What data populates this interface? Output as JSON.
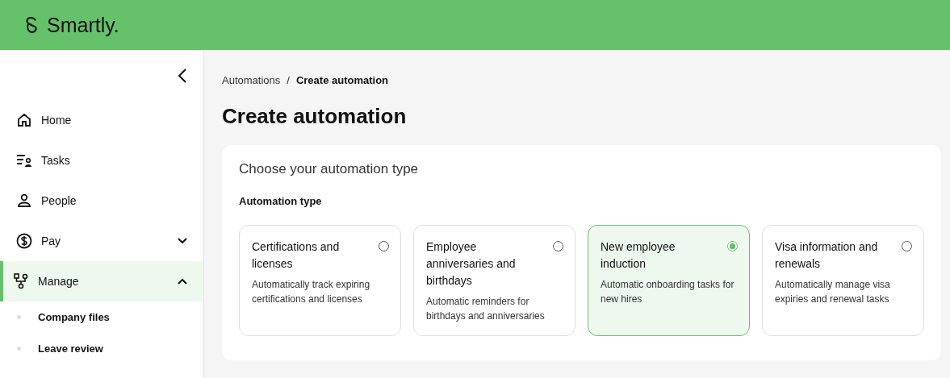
{
  "header": {
    "logo_text": "Smartly."
  },
  "sidebar": {
    "items": [
      {
        "label": "Home",
        "selected": false
      },
      {
        "label": "Tasks",
        "selected": false
      },
      {
        "label": "People",
        "selected": false
      },
      {
        "label": "Pay",
        "expanded": false,
        "selected": false
      },
      {
        "label": "Manage",
        "expanded": true,
        "selected": true,
        "children": [
          {
            "label": "Company files",
            "selected": false
          },
          {
            "label": "Leave review",
            "selected": false
          }
        ]
      }
    ]
  },
  "breadcrumb": [
    {
      "label": "Automations",
      "current": false
    },
    {
      "label": "Create automation",
      "current": true
    }
  ],
  "breadcrumb_separator": "/",
  "page_title": "Create automation",
  "panel": {
    "title": "Choose your automation type",
    "field_label": "Automation type",
    "options": [
      {
        "title": "Certifications and licenses",
        "description": "Automatically track expiring certifications and licenses",
        "selected": false
      },
      {
        "title": "Employee anniversaries and birthdays",
        "description": "Automatic reminders for birthdays and anniversaries",
        "selected": false
      },
      {
        "title": "New employee induction",
        "description": "Automatic onboarding tasks for new hires",
        "selected": true
      },
      {
        "title": "Visa information and renewals",
        "description": "Automatically manage visa expiries and renewal tasks",
        "selected": false
      }
    ]
  }
}
